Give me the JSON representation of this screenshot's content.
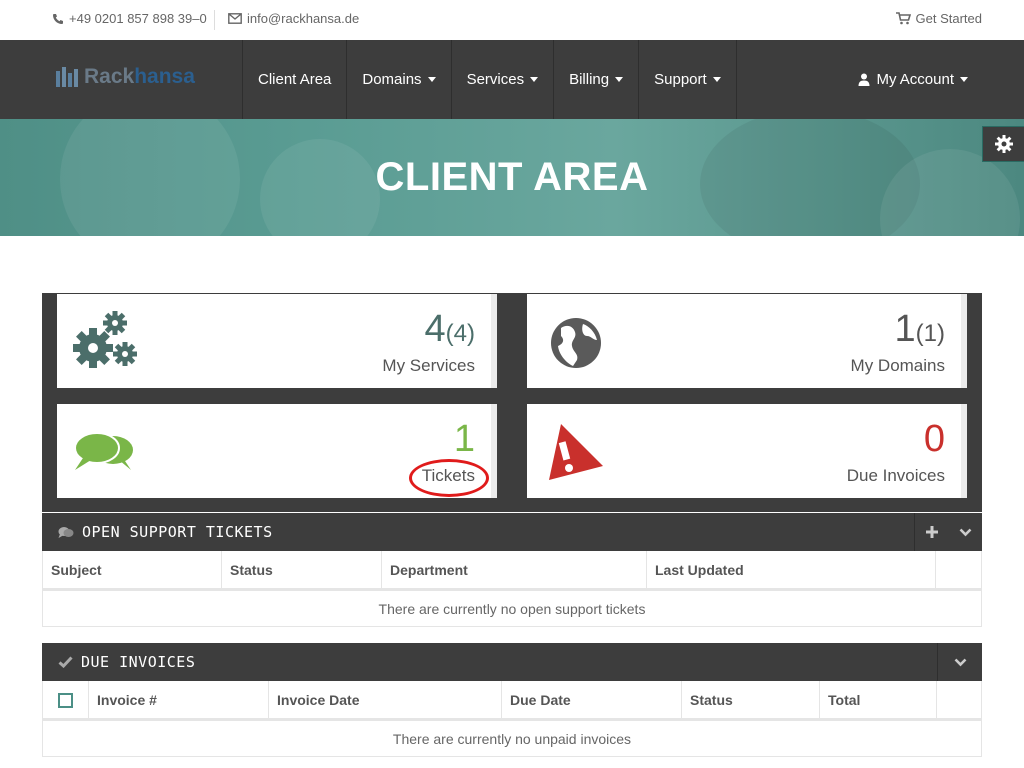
{
  "topbar": {
    "phone": "+49 0201 857 898 39–0",
    "email": "info@rackhansa.de",
    "get_started": "Get Started"
  },
  "logo": {
    "part1": "Rack",
    "part2": "hansa"
  },
  "nav": {
    "items": [
      {
        "label": "Client Area",
        "dropdown": false
      },
      {
        "label": "Domains",
        "dropdown": true
      },
      {
        "label": "Services",
        "dropdown": true
      },
      {
        "label": "Billing",
        "dropdown": true
      },
      {
        "label": "Support",
        "dropdown": true
      }
    ],
    "account": "My Account"
  },
  "hero": {
    "title": "CLIENT AREA"
  },
  "tiles": {
    "services": {
      "count": "4",
      "total": "(4)",
      "label": "My Services",
      "icon": "gears-icon"
    },
    "domains": {
      "count": "1",
      "total": "(1)",
      "label": "My Domains",
      "icon": "globe-icon"
    },
    "tickets": {
      "count": "1",
      "label": "Tickets",
      "icon": "chat-bubbles-icon"
    },
    "invoices": {
      "count": "0",
      "label": "Due Invoices",
      "icon": "warning-icon"
    }
  },
  "tickets_panel": {
    "title": "OPEN SUPPORT TICKETS",
    "columns": [
      "Subject",
      "Status",
      "Department",
      "Last Updated"
    ],
    "empty": "There are currently no open support tickets"
  },
  "invoices_panel": {
    "title": "DUE INVOICES",
    "columns": [
      "Invoice #",
      "Invoice Date",
      "Due Date",
      "Status",
      "Total"
    ],
    "empty": "There are currently no unpaid invoices"
  },
  "colors": {
    "nav_bg": "#3d3d3d",
    "hero_teal": "#5a9c93",
    "tickets_green": "#7ab648",
    "invoices_red": "#c9302c",
    "highlight_ring": "#e01b1b"
  }
}
